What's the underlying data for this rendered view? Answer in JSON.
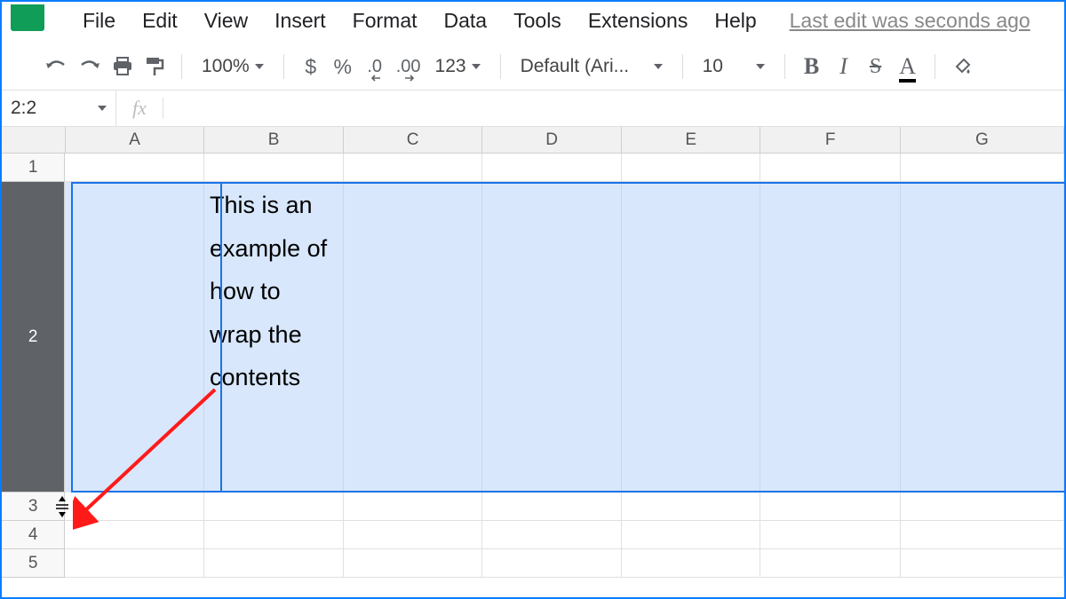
{
  "menubar": {
    "items": [
      "File",
      "Edit",
      "View",
      "Insert",
      "Format",
      "Data",
      "Tools",
      "Extensions",
      "Help"
    ],
    "last_edit": "Last edit was seconds ago"
  },
  "toolbar": {
    "zoom": "100%",
    "currency": "$",
    "percent": "%",
    "dec_dec": ".0",
    "inc_dec": ".00",
    "more_formats": "123",
    "font": "Default (Ari...",
    "font_size": "10",
    "bold": "B",
    "italic": "I",
    "strike": "S",
    "text_color": "A"
  },
  "namebox": {
    "ref": "2:2"
  },
  "formula": {
    "fx": "fx",
    "value": ""
  },
  "columns": [
    "A",
    "B",
    "C",
    "D",
    "E",
    "F",
    "G"
  ],
  "rows": [
    "1",
    "2",
    "3",
    "4",
    "5"
  ],
  "cells": {
    "B2": "This is an example of how to wrap the contents"
  },
  "selection": {
    "row": "2"
  }
}
